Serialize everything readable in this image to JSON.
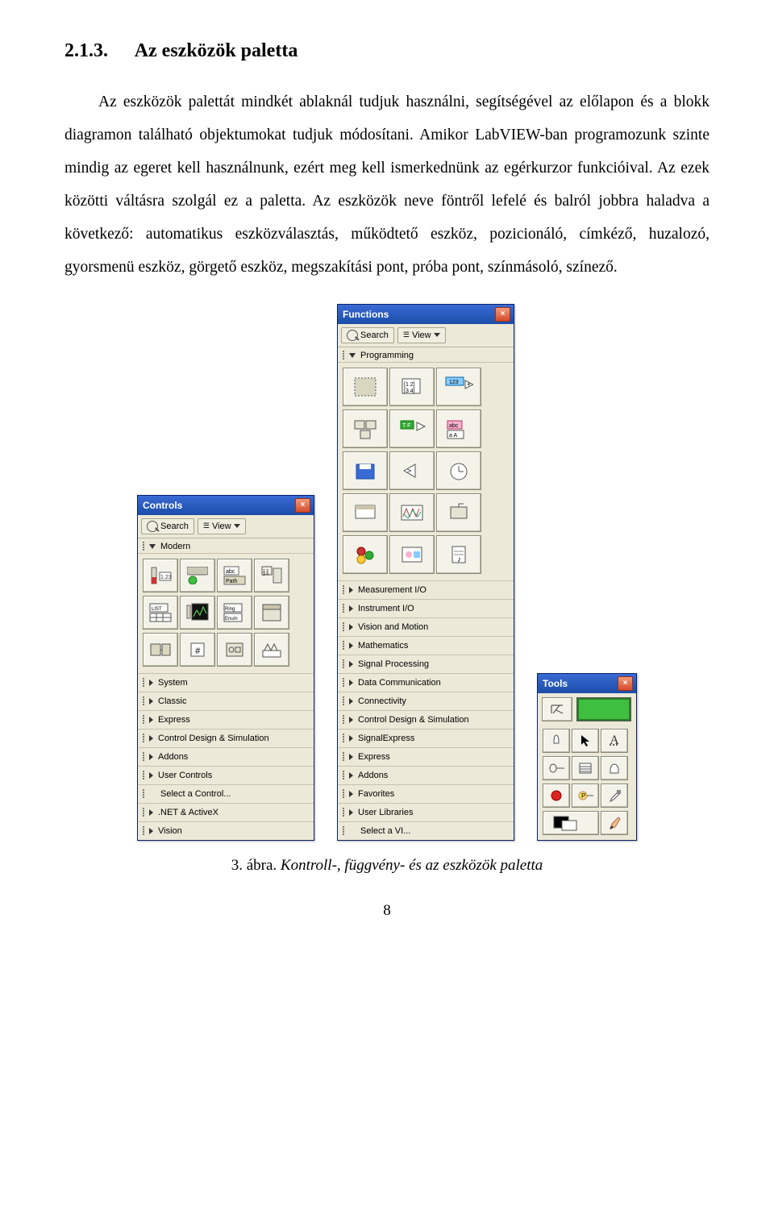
{
  "heading": {
    "number": "2.1.3.",
    "title": "Az eszközök paletta"
  },
  "paragraph": "Az eszközök palettát mindkét ablaknál tudjuk használni, segítségével az előlapon és a blokk diagramon található objektumokat tudjuk módosítani. Amikor LabVIEW-ban programozunk szinte mindig az egeret kell használnunk, ezért meg kell ismerkednünk az egérkurzor funkcióival. Az ezek közötti váltásra szolgál ez a paletta. Az eszközök neve föntről lefelé és balról jobbra haladva a következő: automatikus eszközválasztás, működtető eszköz, pozicionáló, címkéző, huzalozó, gyorsmenü eszköz, görgető eszköz, megszakítási pont, próba pont, színmásoló, színező.",
  "caption": {
    "number": "3. ábra.",
    "text": "Kontroll-, függvény- és az eszközök paletta"
  },
  "pagenum": "8",
  "controls": {
    "title": "Controls",
    "search": "Search",
    "view": "View",
    "category": "Modern",
    "items": [
      "System",
      "Classic",
      "Express",
      "Control Design & Simulation",
      "Addons",
      "User Controls",
      "Select a Control...",
      ".NET & ActiveX",
      "Vision"
    ]
  },
  "functions": {
    "title": "Functions",
    "search": "Search",
    "view": "View",
    "category": "Programming",
    "items": [
      "Measurement I/O",
      "Instrument I/O",
      "Vision and Motion",
      "Mathematics",
      "Signal Processing",
      "Data Communication",
      "Connectivity",
      "Control Design & Simulation",
      "SignalExpress",
      "Express",
      "Addons",
      "Favorites",
      "User Libraries",
      "Select a VI..."
    ]
  },
  "tools": {
    "title": "Tools"
  }
}
